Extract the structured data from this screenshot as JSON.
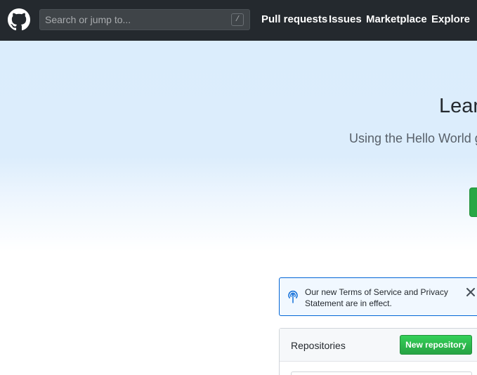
{
  "header": {
    "logo_icon": "github-octocat-icon",
    "search": {
      "placeholder": "Search or jump to...",
      "shortcut_key": "/"
    },
    "nav": [
      {
        "label": "Pull requests"
      },
      {
        "label": "Issues"
      },
      {
        "label": "Marketplace"
      },
      {
        "label": "Explore"
      }
    ]
  },
  "hero": {
    "title": "Lean",
    "subtitle": "Using the Hello World g"
  },
  "notice": {
    "icon": "broadcast-icon",
    "text": "Our new Terms of Service and Privacy Statement are in effect.",
    "close_icon": "close-icon"
  },
  "repositories": {
    "title": "Repositories",
    "new_button_label": "New repository"
  },
  "colors": {
    "header_bg": "#24292e",
    "hero_bg": "#dbedfc",
    "primary_green": "#28a745",
    "notice_border": "#0366d6",
    "link_blue": "#0366d6"
  }
}
